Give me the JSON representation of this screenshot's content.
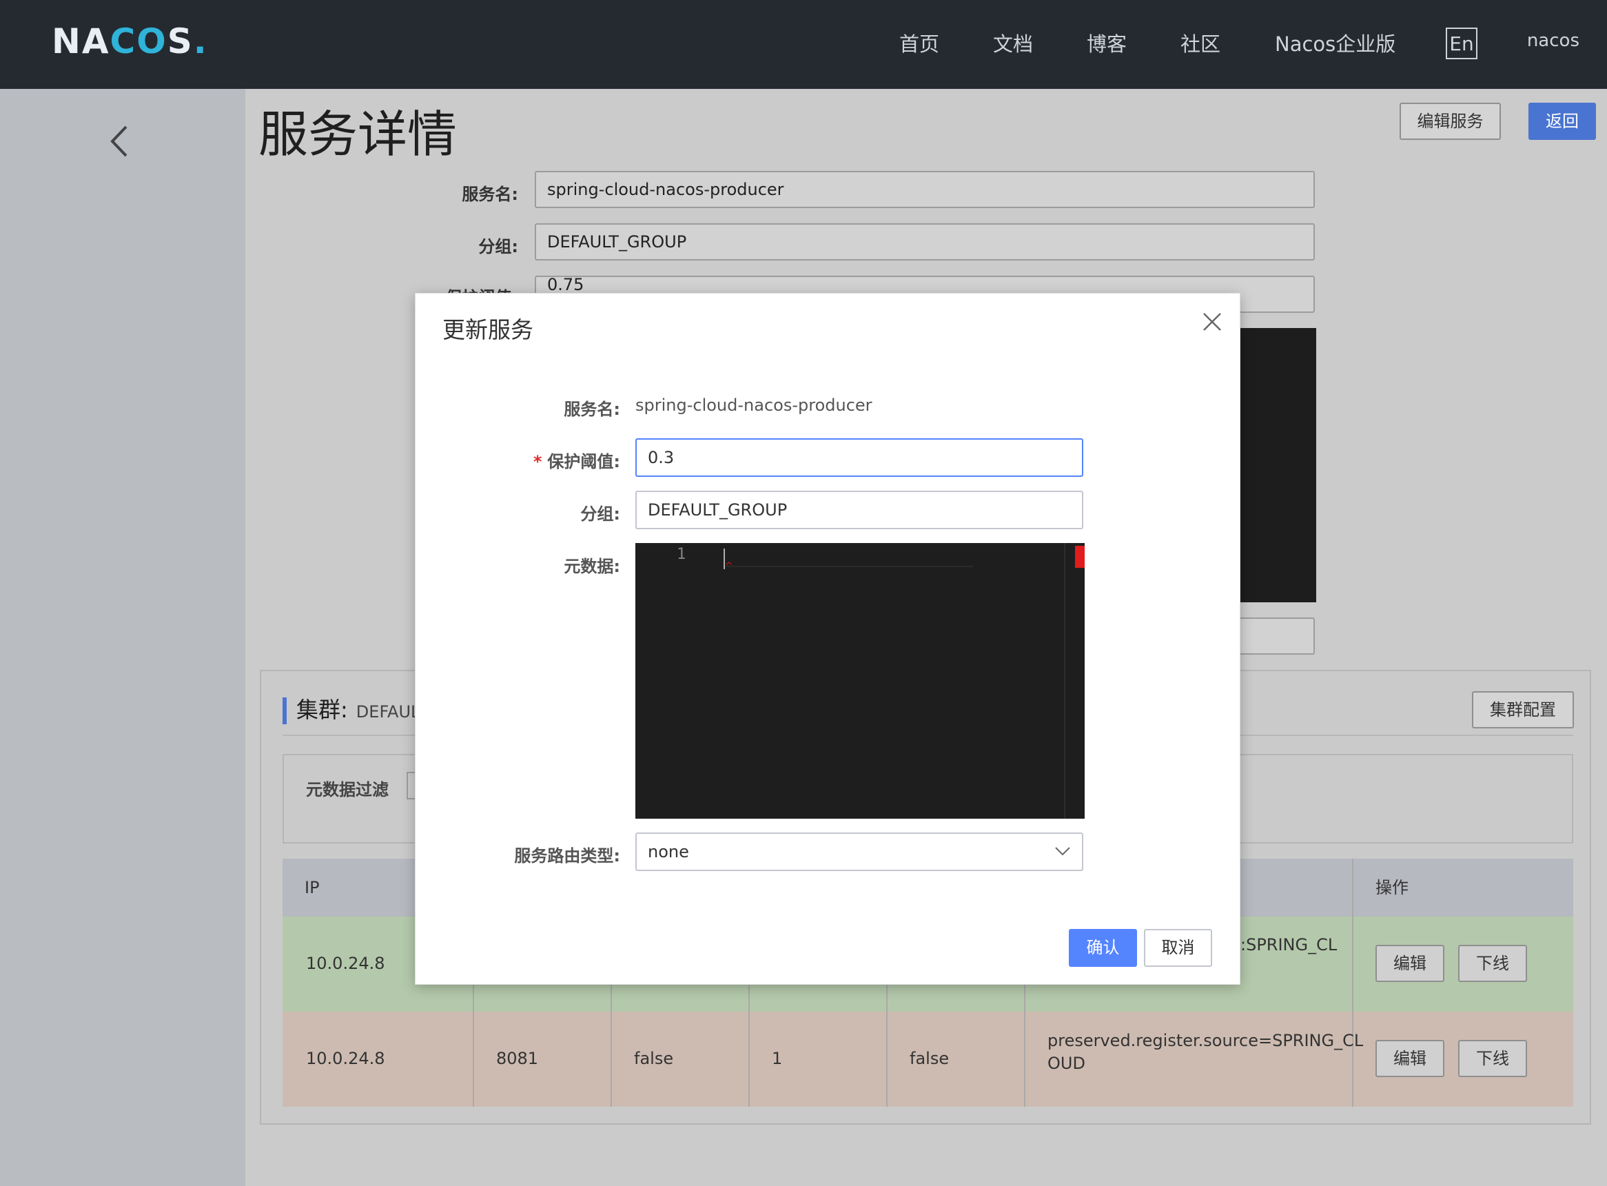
{
  "brand": {
    "logo_prefix": "NA",
    "logo_co": "CO",
    "logo_suffix": "S",
    "logo_dot": ".",
    "accent": "#2fb3d9"
  },
  "topnav": {
    "items": [
      "首页",
      "文档",
      "博客",
      "社区",
      "Nacos企业版"
    ],
    "lang": "En",
    "user": "nacos"
  },
  "page": {
    "title": "服务详情",
    "edit_service_button": "编辑服务",
    "back_button": "返回",
    "primary_color": "#4a74d1"
  },
  "detail": {
    "service_name_label": "服务名:",
    "service_name_value": "spring-cloud-nacos-producer",
    "group_label": "分组:",
    "group_value": "DEFAULT_GROUP",
    "threshold_label": "保护阈值:",
    "threshold_value": "0.75"
  },
  "cluster": {
    "title": "集群:",
    "name": "DEFAUL",
    "config_button": "集群配置",
    "filter_label": "元数据过滤",
    "table": {
      "headers": [
        "IP",
        "操作"
      ],
      "rows": [
        {
          "ip": "10.0.24.8",
          "port": "",
          "ephemeral": "",
          "weight": "",
          "healthy": "",
          "metadata": ":SPRING_CL",
          "metadata2": "",
          "edit": "编辑",
          "offline": "下线",
          "color": "#b4c9ab"
        },
        {
          "ip": "10.0.24.8",
          "port": "8081",
          "ephemeral": "false",
          "weight": "1",
          "healthy": "false",
          "metadata": "preserved.register.source=SPRING_CL",
          "metadata2": "OUD",
          "edit": "编辑",
          "offline": "下线",
          "color": "#cdbbb1"
        }
      ]
    }
  },
  "modal": {
    "title": "更新服务",
    "service_name_label": "服务名:",
    "service_name_value": "spring-cloud-nacos-producer",
    "required_mark": "*",
    "threshold_label": "保护阈值:",
    "threshold_value": "0.3",
    "group_label": "分组:",
    "group_value": "DEFAULT_GROUP",
    "metadata_label": "元数据:",
    "editor_line_number": "1",
    "route_type_label": "服务路由类型:",
    "route_type_value": "none",
    "confirm_button": "确认",
    "cancel_button": "取消",
    "confirm_color": "#5584ff"
  }
}
